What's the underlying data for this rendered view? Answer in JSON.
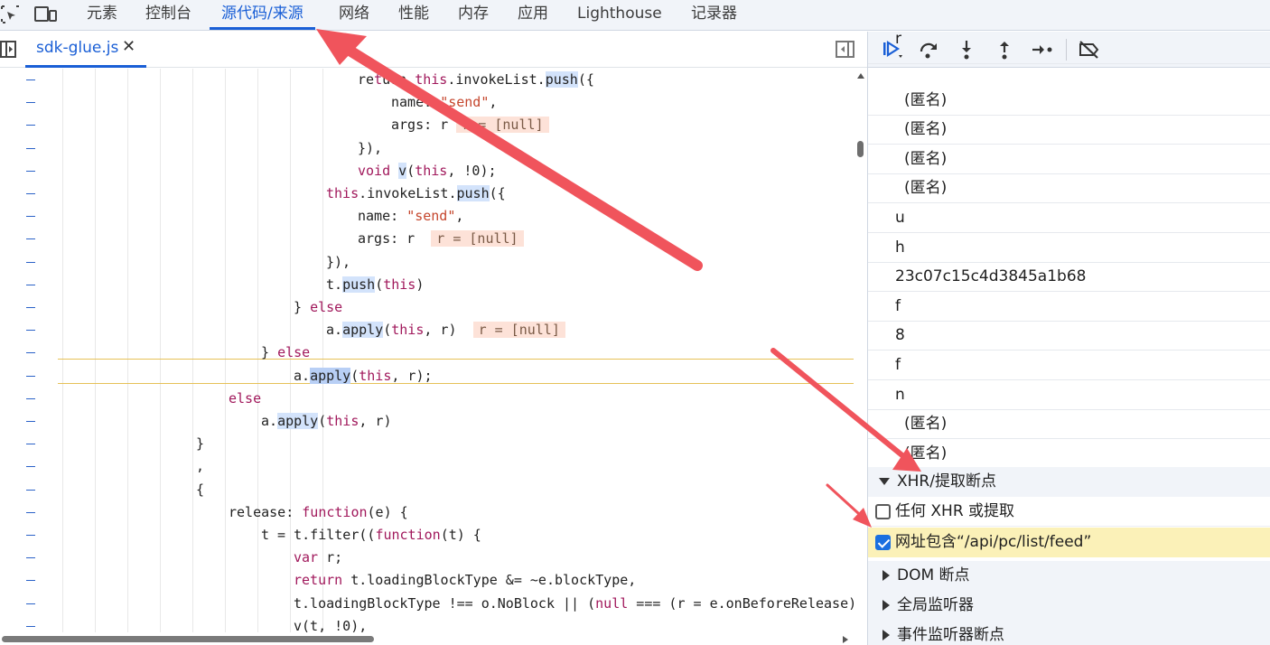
{
  "top_tabs": [
    "元素",
    "控制台",
    "源代码/来源",
    "网络",
    "性能",
    "内存",
    "应用",
    "Lighthouse",
    "记录器"
  ],
  "active_tab": "源代码/来源",
  "file_tab": {
    "name": "sdk-glue.js",
    "close": "✕"
  },
  "code_lines": [
    [
      {
        "t": "re"
      },
      {
        "t": "t",
        "c": "kw"
      },
      {
        "t": "u"
      },
      {
        "t": "rn "
      },
      {
        "t": "this",
        "c": "kw"
      },
      {
        "t": ".invokeList."
      },
      {
        "t": "push",
        "c": "hl"
      },
      {
        "t": "({"
      }
    ],
    [
      {
        "t": "nam"
      },
      {
        "t": "e: "
      },
      {
        "t": "\"send\"",
        "c": "str"
      },
      {
        "t": ","
      }
    ],
    [
      {
        "t": "args: r "
      },
      {
        "t": "r = [null]",
        "c": "inline-val"
      }
    ],
    [
      {
        "t": "}),"
      }
    ],
    [
      {
        "t": "void ",
        "c": "kw"
      },
      {
        "t": "v",
        "c": "hl"
      },
      {
        "t": "("
      },
      {
        "t": "this",
        "c": "kw"
      },
      {
        "t": ", !0);"
      }
    ],
    [
      {
        "t": "this",
        "c": "kw"
      },
      {
        "t": ".invokeList."
      },
      {
        "t": "push",
        "c": "hl"
      },
      {
        "t": "({"
      }
    ],
    [
      {
        "t": "name: "
      },
      {
        "t": "\"send\"",
        "c": "str"
      },
      {
        "t": ","
      }
    ],
    [
      {
        "t": "args: r  "
      },
      {
        "t": "r = [null]",
        "c": "inline-val"
      }
    ],
    [
      {
        "t": "}),"
      }
    ],
    [
      {
        "t": "t."
      },
      {
        "t": "push",
        "c": "hl"
      },
      {
        "t": "("
      },
      {
        "t": "this",
        "c": "kw"
      },
      {
        "t": ")"
      }
    ],
    [
      {
        "t": "} "
      },
      {
        "t": "else",
        "c": "kw"
      }
    ],
    [
      {
        "t": "a."
      },
      {
        "t": "apply",
        "c": "hl"
      },
      {
        "t": "("
      },
      {
        "t": "this",
        "c": "kw"
      },
      {
        "t": ", r)  "
      },
      {
        "t": "r = [null]",
        "c": "inline-val"
      }
    ],
    [
      {
        "t": "} "
      },
      {
        "t": "else",
        "c": "kw"
      }
    ],
    [
      {
        "t": "a."
      },
      {
        "t": "apply",
        "c": "hl-strong"
      },
      {
        "t": "("
      },
      {
        "t": "this",
        "c": "kw"
      },
      {
        "t": ", r);"
      }
    ],
    [
      {
        "t": "else",
        "c": "kw"
      }
    ],
    [
      {
        "t": "a."
      },
      {
        "t": "apply",
        "c": "hl"
      },
      {
        "t": "("
      },
      {
        "t": "this",
        "c": "kw"
      },
      {
        "t": ", r)"
      }
    ],
    [
      {
        "t": "}"
      }
    ],
    [
      {
        "t": ","
      }
    ],
    [
      {
        "t": "{"
      }
    ],
    [
      {
        "t": "release: "
      },
      {
        "t": "function",
        "c": "kw"
      },
      {
        "t": "(e) {"
      }
    ],
    [
      {
        "t": "t = t.filter(("
      },
      {
        "t": "function",
        "c": "kw"
      },
      {
        "t": "(t) {"
      }
    ],
    [
      {
        "t": "var ",
        "c": "kw"
      },
      {
        "t": "r;"
      }
    ],
    [
      {
        "t": "return ",
        "c": "kw"
      },
      {
        "t": "t.loadingBlockType &= ~e.blockType,"
      }
    ],
    [
      {
        "t": "t.loadingBlockType !== o.NoBlock || ("
      },
      {
        "t": "null",
        "c": "kw"
      },
      {
        "t": " === (r = e.onBeforeRelease)"
      }
    ],
    [
      {
        "t": "v(t, !0),"
      }
    ]
  ],
  "call_stack": [
    "r",
    "(匿名)",
    "(匿名)",
    "(匿名)",
    "(匿名)",
    "u",
    "h",
    "23c07c15c4d3845a1b68",
    "f",
    "8",
    "f",
    "n",
    "(匿名)",
    "(匿名)"
  ],
  "xhr_section": {
    "title": "XHR/提取断点",
    "items": [
      {
        "label": "任何 XHR 或提取",
        "checked": false
      },
      {
        "label": "网址包含“/api/pc/list/feed”",
        "checked": true
      }
    ]
  },
  "collapsed_sections": [
    "DOM 断点",
    "全局监听器",
    "事件监听器断点"
  ],
  "colors": {
    "accent": "#1a5fd6",
    "annotation_arrow": "#f0545c",
    "highlight_row": "#fbf1b8"
  }
}
